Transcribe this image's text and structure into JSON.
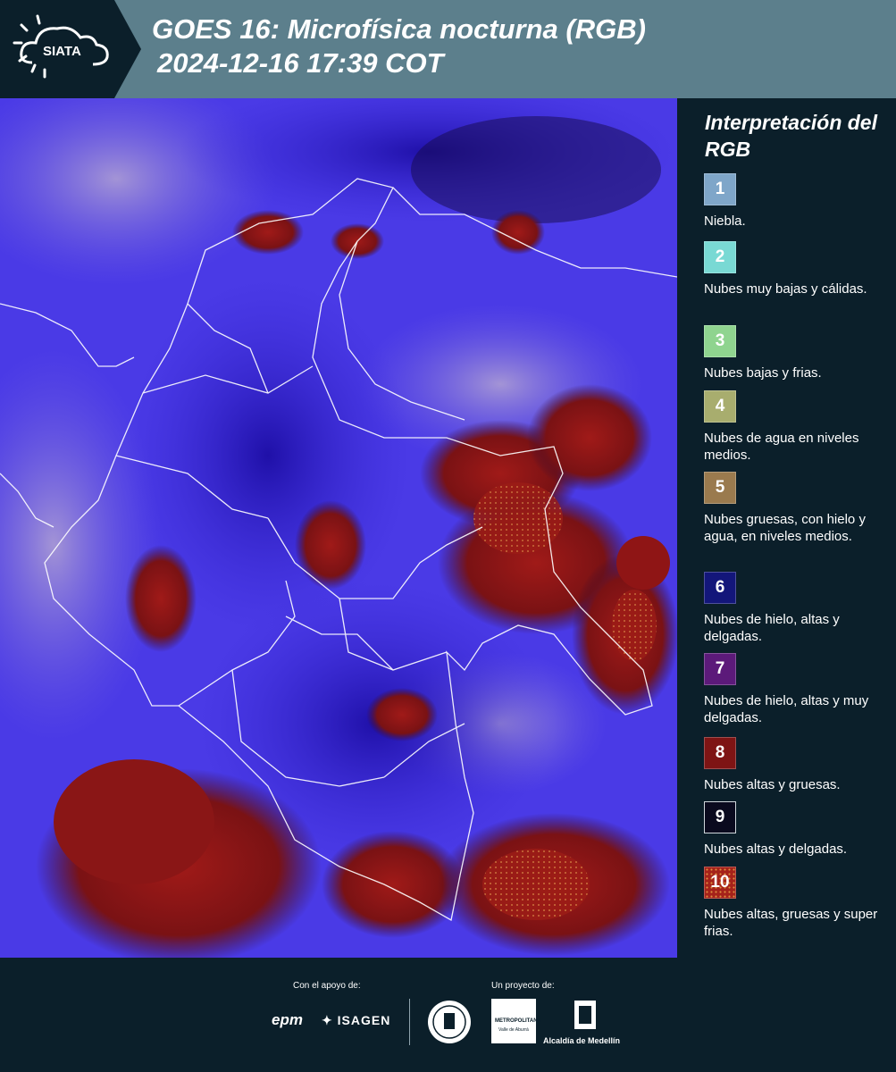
{
  "header": {
    "logo_text": "SIATA",
    "title_line1": "GOES 16: Microfísica nocturna (RGB)",
    "title_line2": "2024-12-16 17:39 COT"
  },
  "legend": {
    "title": "Interpretación del RGB",
    "items": [
      {
        "number": "1",
        "color": "#7fa6c9",
        "text": "Niebla."
      },
      {
        "number": "2",
        "color": "#79d9d4",
        "text": "Nubes muy bajas y cálidas."
      },
      {
        "number": "3",
        "color": "#8fd48f",
        "text": "Nubes bajas y frias."
      },
      {
        "number": "4",
        "color": "#a8ad6e",
        "text": "Nubes de agua en niveles medios."
      },
      {
        "number": "5",
        "color": "#9a7a4e",
        "text": "Nubes gruesas, con hielo y agua, en niveles medios."
      },
      {
        "number": "6",
        "color": "#13167a",
        "text": "Nubes de hielo, altas y delgadas."
      },
      {
        "number": "7",
        "color": "#5c1a7a",
        "text": "Nubes de hielo, altas y muy delgadas."
      },
      {
        "number": "8",
        "color": "#7e1414",
        "text": "Nubes altas y gruesas."
      },
      {
        "number": "9",
        "color": "#0a0a1e",
        "text": "Nubes altas y delgadas."
      },
      {
        "number": "10",
        "color": "#a5221a",
        "text": "Nubes altas, gruesas y super frias."
      }
    ]
  },
  "footer": {
    "support_label": "Con el apoyo de:",
    "project_label": "Un proyecto de:",
    "epm": "epm",
    "isagen": "ISAGEN",
    "area_name": "METROPOLITANA",
    "area_sub": "Valle de Aburrá",
    "alcaldia": "Alcaldía de Medellín"
  }
}
